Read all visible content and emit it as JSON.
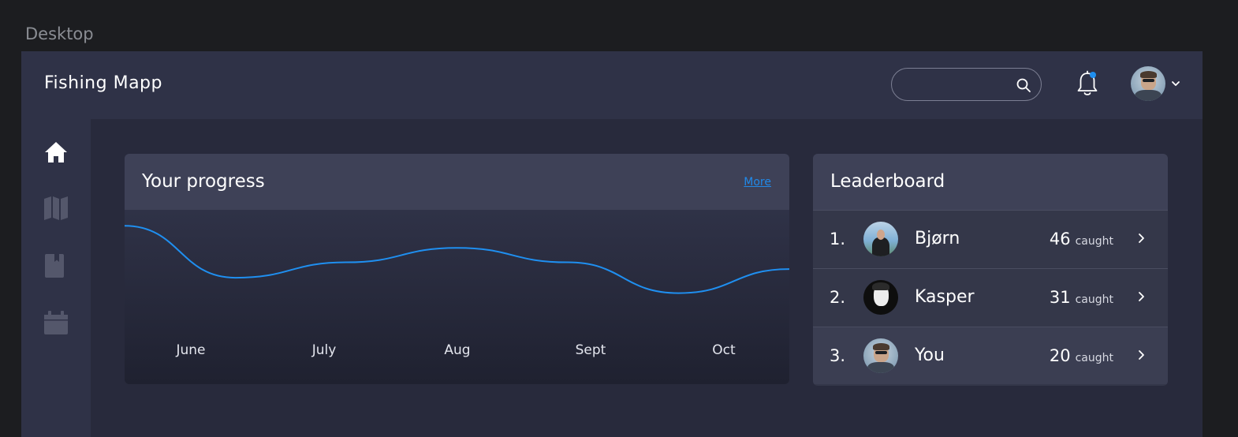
{
  "frame_label": "Desktop",
  "app": {
    "title": "Fishing Mapp"
  },
  "header": {
    "search": {
      "placeholder": "",
      "value": ""
    },
    "notifications": {
      "has_unread": true,
      "dot_color": "#1f8ff0"
    }
  },
  "sidebar": {
    "items": [
      {
        "name": "home",
        "icon": "home-icon",
        "active": true
      },
      {
        "name": "map",
        "icon": "map-icon",
        "active": false
      },
      {
        "name": "logbook",
        "icon": "book-icon",
        "active": false
      },
      {
        "name": "calendar",
        "icon": "calendar-icon",
        "active": false
      }
    ]
  },
  "progress": {
    "title": "Your progress",
    "more_label": "More"
  },
  "chart_data": {
    "type": "line",
    "categories": [
      "June",
      "July",
      "Aug",
      "Sept",
      "Oct"
    ],
    "title": "Your progress",
    "xlabel": "",
    "ylabel": "",
    "grid": false,
    "line_color": "#1f8ff0",
    "note_values": "relative trend, no y-axis printed",
    "series": [
      {
        "values": [
          0.9,
          0.36,
          0.52,
          0.67,
          0.52,
          0.2,
          0.45
        ]
      }
    ]
  },
  "leaderboard": {
    "title": "Leaderboard",
    "rows": [
      {
        "rank": "1.",
        "name": "Bjørn",
        "count": "46",
        "unit": "caught",
        "highlight": false
      },
      {
        "rank": "2.",
        "name": "Kasper",
        "count": "31",
        "unit": "caught",
        "highlight": false
      },
      {
        "rank": "3.",
        "name": "You",
        "count": "20",
        "unit": "caught",
        "highlight": true
      }
    ]
  },
  "colors": {
    "accent": "#1f8ff0",
    "background": "#282a3c",
    "topbar": "#2f3247"
  }
}
